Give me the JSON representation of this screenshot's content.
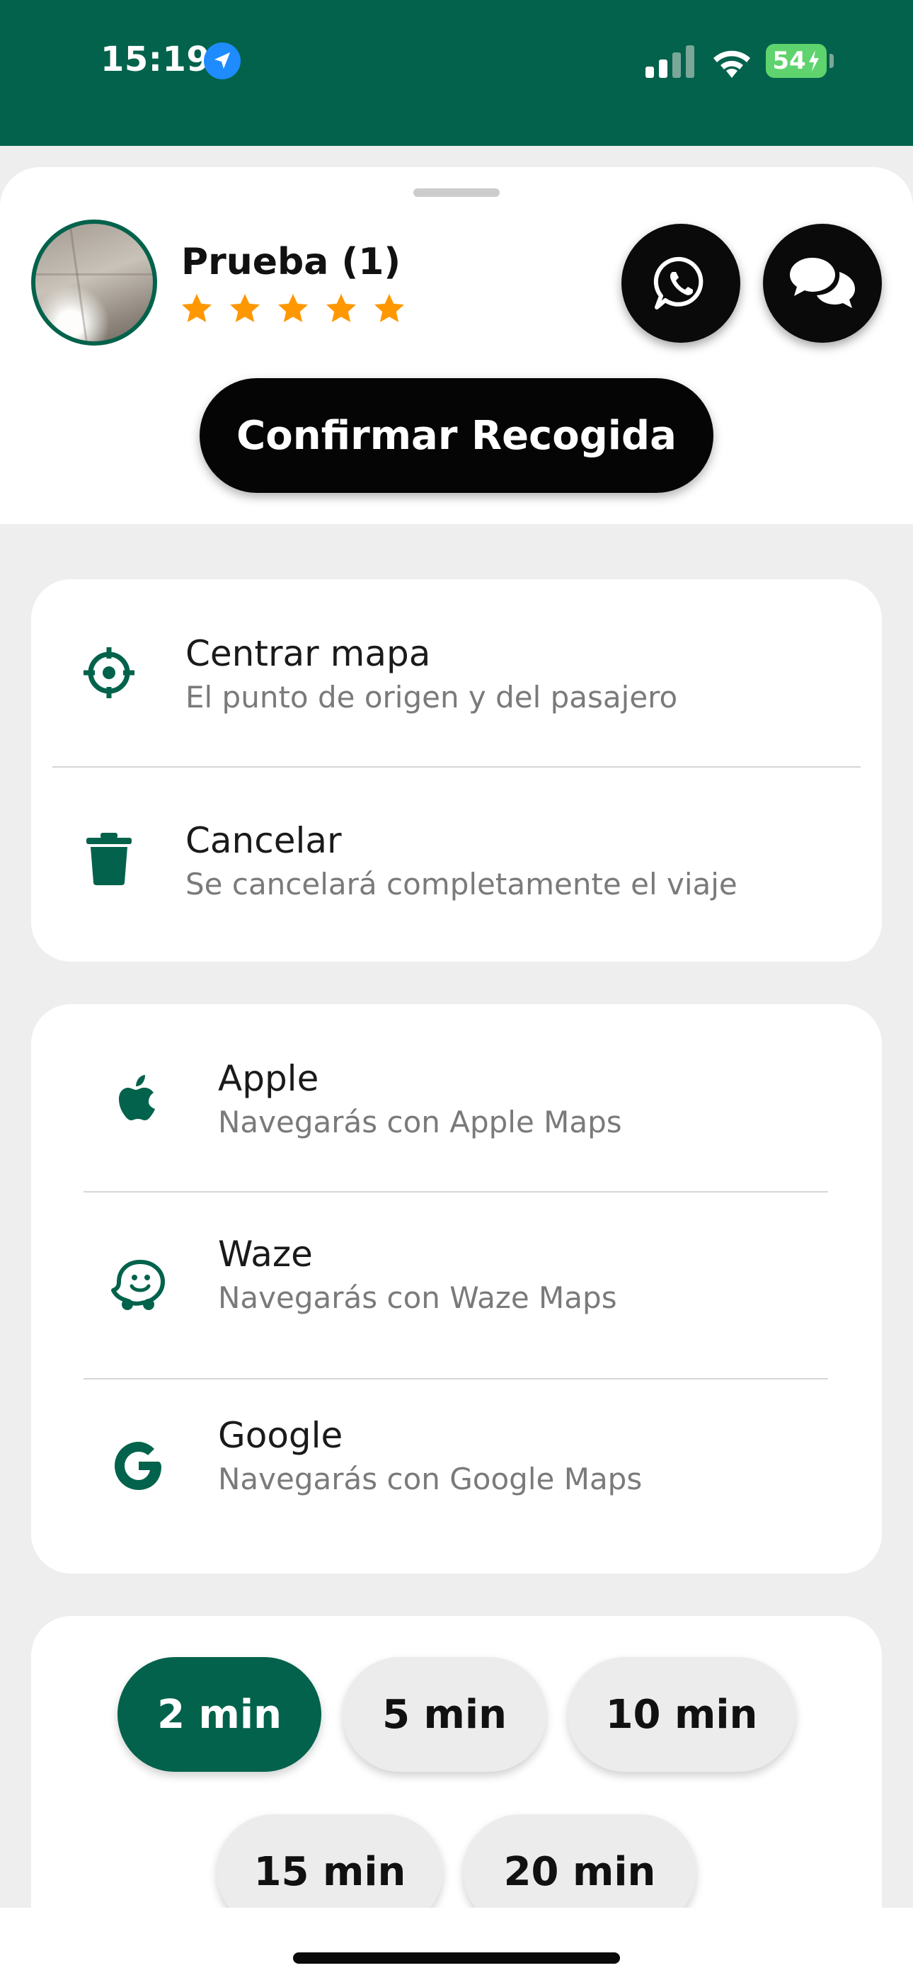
{
  "status_bar": {
    "time": "15:19",
    "battery": "54"
  },
  "passenger": {
    "name": "Prueba (1)",
    "rating": 5,
    "rating_max": 5
  },
  "actions": {
    "whatsapp_icon": "whatsapp-icon",
    "chat_icon": "chat-bubbles-icon",
    "confirm_label": "Confirmar Recogida"
  },
  "menu": [
    {
      "icon": "crosshair-icon",
      "title": "Centrar mapa",
      "subtitle": "El punto de origen y del pasajero"
    },
    {
      "icon": "trash-icon",
      "title": "Cancelar",
      "subtitle": "Se cancelará completamente el viaje"
    }
  ],
  "navigation": [
    {
      "icon": "apple-icon",
      "title": "Apple",
      "subtitle": "Navegarás con Apple Maps"
    },
    {
      "icon": "waze-icon",
      "title": "Waze",
      "subtitle": "Navegarás con Waze Maps"
    },
    {
      "icon": "google-icon",
      "title": "Google",
      "subtitle": "Navegarás con Google Maps"
    }
  ],
  "time_options": {
    "selected": "2 min",
    "items": [
      "2 min",
      "5 min",
      "10 min",
      "15 min",
      "20 min"
    ]
  },
  "colors": {
    "brand": "#03624b",
    "star": "#ff9800"
  }
}
